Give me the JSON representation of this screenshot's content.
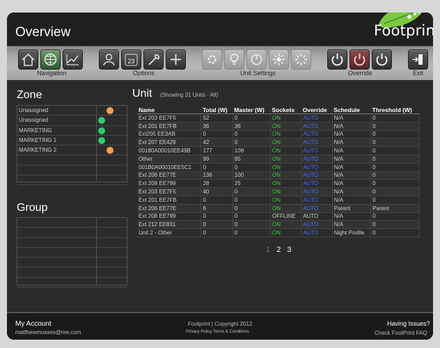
{
  "header": {
    "title": "Overview",
    "brand": "Footprint"
  },
  "toolbar": {
    "groups": {
      "navigation": "Navigation",
      "options": "Options",
      "unit_settings": "Unit Settings",
      "override": "Override",
      "exit": "Exit"
    },
    "calendar_day": "23"
  },
  "zone": {
    "title": "Zone",
    "rows": [
      {
        "name": "Unassigned",
        "dot": "orange"
      },
      {
        "name": "Unassigned",
        "dot": "green"
      },
      {
        "name": "MARKETING",
        "dot": "green"
      },
      {
        "name": "MARKETING 1",
        "dot": "green"
      },
      {
        "name": "MARKETING 2",
        "dot": "orange"
      }
    ]
  },
  "group": {
    "title": "Group"
  },
  "unit": {
    "title": "Unit",
    "subtitle": "(Showing 31 Units - All)",
    "columns": [
      "Name",
      "Total (W)",
      "Master (W)",
      "Sockets",
      "Override",
      "Schedule",
      "Threshold (W)"
    ],
    "rows": [
      [
        "Ext 203 EE7F5",
        "52",
        "0",
        "ON",
        "AUTO",
        "N/A",
        "0"
      ],
      [
        "Ext 201 EE7FB",
        "36",
        "36",
        "ON",
        "AUTO",
        "N/A",
        "0"
      ],
      [
        "Ext205 EE3AB",
        "0",
        "0",
        "ON",
        "AUTO",
        "N/A",
        "0"
      ],
      [
        "Ext 207 EE429",
        "42",
        "0",
        "ON",
        "AUTO",
        "N/A",
        "0"
      ],
      [
        "00180A00010EE49B",
        "177",
        "108",
        "ON",
        "AUTO",
        "N/A",
        "0"
      ],
      [
        "Other",
        "99",
        "85",
        "ON",
        "AUTO",
        "N/A",
        "0"
      ],
      [
        "001B0A00010EE5C1",
        "0",
        "0",
        "ON",
        "AUTO",
        "N/A",
        "0"
      ],
      [
        "Ext 206 EE77E",
        "136",
        "100",
        "ON",
        "AUTO",
        "N/A",
        "0"
      ],
      [
        "Ext 208 EE799",
        "28",
        "25",
        "ON",
        "AUTO",
        "N/A",
        "0"
      ],
      [
        "Ext 203 EE7F5",
        "40",
        "0",
        "ON",
        "AUTO",
        "N/A",
        "0"
      ],
      [
        "Ext 201 EE7FB",
        "0",
        "0",
        "ON",
        "AUTO",
        "N/A",
        "0"
      ],
      [
        "Ext 206 EE77E",
        "6",
        "0",
        "ON",
        "AUTO",
        "Parent",
        "Parent"
      ],
      [
        "Ext 208 EE799",
        "0",
        "0",
        "OFFLINE",
        "AUTO",
        "N/A",
        "0"
      ],
      [
        "Ext 212 EE831",
        "0",
        "0",
        "ON",
        "AUTO",
        "N/A",
        "0"
      ],
      [
        "Unit 2 - Other",
        "0",
        "0",
        "ON",
        "AUTO",
        "Night Profile",
        "0"
      ]
    ],
    "pages": [
      "1",
      "2",
      "3"
    ]
  },
  "footer": {
    "account_title": "My Account",
    "account_email": "matthewmosses@me.com",
    "copyright": "Footprint | Copyright 2012",
    "links": "Privacy Policy   Terms & Conditions",
    "help_title": "Having Issues?",
    "help_link": "Check FootPrint FAQ"
  },
  "colors": {
    "on": "#35d235",
    "auto": "#3f6dff",
    "dot_green": "#2ecc71",
    "dot_orange": "#f5a04a"
  }
}
